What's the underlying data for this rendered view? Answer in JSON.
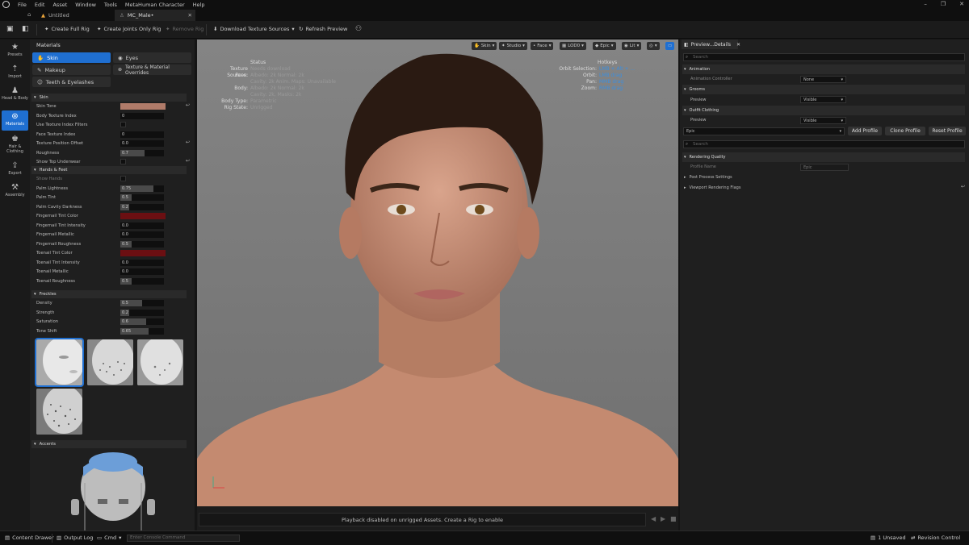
{
  "menu": [
    "File",
    "Edit",
    "Asset",
    "Window",
    "Tools",
    "MetaHuman Character",
    "Help"
  ],
  "tabs": [
    {
      "label": "Untitled"
    },
    {
      "label": "MC_Male•"
    }
  ],
  "toolbar": {
    "create_full_rig": "Create Full Rig",
    "create_joints_rig": "Create Joints Only Rig",
    "remove_rig": "Remove Rig",
    "download_textures": "Download Texture Sources",
    "refresh_preview": "Refresh Preview"
  },
  "rail": [
    {
      "label": "Presets",
      "icon": "star-icon"
    },
    {
      "label": "Import",
      "icon": "import-icon"
    },
    {
      "label": "Head & Body",
      "icon": "body-icon"
    },
    {
      "label": "Materials",
      "icon": "materials-icon",
      "active": true
    },
    {
      "label": "Hair & Clothing",
      "icon": "hair-icon"
    },
    {
      "label": "Export",
      "icon": "export-icon"
    },
    {
      "label": "Assembly",
      "icon": "assembly-icon"
    }
  ],
  "materials": {
    "title": "Materials",
    "tabs": {
      "skin": "Skin",
      "eyes": "Eyes",
      "makeup": "Makeup",
      "texture_overrides": "Texture & Material Overrides",
      "teeth": "Teeth & Eyelashes"
    },
    "skin_section": "Skin",
    "skin_rows": [
      {
        "label": "Skin Tone",
        "type": "color",
        "color": "#b07b69",
        "reset": true
      },
      {
        "label": "Body Texture Index",
        "type": "value",
        "value": "0"
      },
      {
        "label": "Use Texture Index Filters",
        "type": "check"
      },
      {
        "label": "Face Texture Index",
        "type": "value",
        "value": "0"
      },
      {
        "label": "Texture Position Offset",
        "type": "value",
        "value": "0.0",
        "reset": true
      },
      {
        "label": "Roughness",
        "type": "value",
        "value": "0.7",
        "fill": 0.55
      },
      {
        "label": "Show Top Underwear",
        "type": "check",
        "reset": true
      }
    ],
    "hands_section": "Hands & Feet",
    "hands_rows": [
      {
        "label": "Show Hands",
        "type": "check",
        "dim": true
      },
      {
        "label": "Palm Lightness",
        "type": "value",
        "value": "0.75",
        "fill": 0.75
      },
      {
        "label": "Palm Tint",
        "type": "value",
        "value": "0.5",
        "fill": 0.25
      },
      {
        "label": "Palm Cavity Darkness",
        "type": "value",
        "value": "0.2",
        "fill": 0.2
      },
      {
        "label": "Fingernail Tint Color",
        "type": "color",
        "color": "#6b0f12"
      },
      {
        "label": "Fingernail Tint Intensity",
        "type": "value",
        "value": "0.0"
      },
      {
        "label": "Fingernail Metallic",
        "type": "value",
        "value": "0.0"
      },
      {
        "label": "Fingernail Roughness",
        "type": "value",
        "value": "0.5",
        "fill": 0.25
      },
      {
        "label": "Toenail Tint Color",
        "type": "color",
        "color": "#6b0f12"
      },
      {
        "label": "Toenail Tint Intensity",
        "type": "value",
        "value": "0.0"
      },
      {
        "label": "Toenail Metallic",
        "type": "value",
        "value": "0.0"
      },
      {
        "label": "Toenail Roughness",
        "type": "value",
        "value": "0.5",
        "fill": 0.25
      }
    ],
    "freckles_section": "Freckles",
    "freckles_rows": [
      {
        "label": "Density",
        "type": "value",
        "value": "0.5",
        "fill": 0.5
      },
      {
        "label": "Strength",
        "type": "value",
        "value": "0.2",
        "fill": 0.2
      },
      {
        "label": "Saturation",
        "type": "value",
        "value": "0.6",
        "fill": 0.6
      },
      {
        "label": "Tone Shift",
        "type": "value",
        "value": "0.65",
        "fill": 0.65
      }
    ],
    "accents_section": "Accents"
  },
  "viewport": {
    "toolbar": [
      "Skin",
      "Studio",
      "Face",
      "LOD0",
      "Epic",
      "Lit"
    ],
    "status": {
      "title": "Status",
      "rows": [
        {
          "label": "Texture Sources:",
          "value": "Needs download"
        },
        {
          "label": "Face:",
          "value": "Albedo: 2k Normal: 2k"
        },
        {
          "label": "",
          "value": "Cavity: 2k  Anim. Maps: Unavailable"
        },
        {
          "label": "Body:",
          "value": "Albedo: 2k Normal: 2k"
        },
        {
          "label": "",
          "value": "Cavity: 2k, Masks: 2k"
        },
        {
          "label": "Body Type:",
          "value": "Parametric"
        },
        {
          "label": "Rig State:",
          "value": "Unrigged"
        }
      ]
    },
    "hotkeys": {
      "title": "Hotkeys",
      "rows": [
        {
          "label": "Orbit Selection:",
          "value": "LMB + Alt + ..."
        },
        {
          "label": "Orbit:",
          "value": "LMB drag"
        },
        {
          "label": "Pan:",
          "value": "MMB drag"
        },
        {
          "label": "Zoom:",
          "value": "RMB drag"
        }
      ]
    },
    "playback_msg": "Playback disabled on unrigged Assets. Create a Rig to enable"
  },
  "details": {
    "tab": "Preview...Details",
    "search_placeholder": "Search",
    "animation": "Animation",
    "animation_controller": "Animation Controller",
    "animation_value": "None",
    "grooms": "Grooms",
    "grooms_preview": "Preview",
    "grooms_value": "Visible",
    "outfit": "Outfit Clothing",
    "outfit_preview": "Preview",
    "outfit_value": "Visible",
    "profile_value": "Epic",
    "add_profile": "Add Profile",
    "clone_profile": "Clone Profile",
    "reset_profile": "Reset Profile",
    "search2_placeholder": "Search",
    "rendering_quality": "Rendering Quality",
    "profile_name": "Profile Name",
    "profile_name_value": "Epic",
    "post_process": "Post Process Settings",
    "viewport_flags": "Viewport Rendering Flags"
  },
  "statusbar": {
    "content_drawer": "Content Drawer",
    "output_log": "Output Log",
    "cmd": "Cmd",
    "console_placeholder": "Enter Console Command",
    "unsaved": "1 Unsaved",
    "revision": "Revision Control"
  }
}
